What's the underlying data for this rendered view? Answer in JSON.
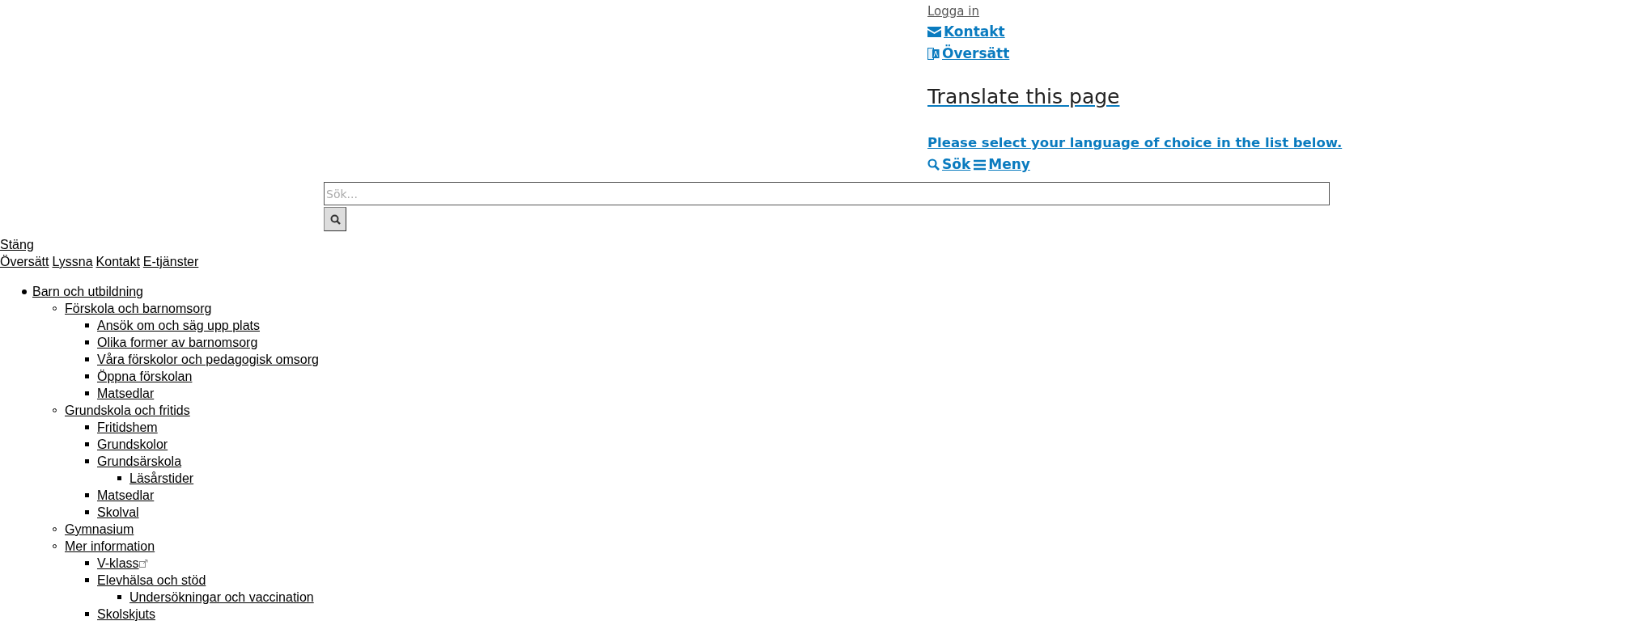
{
  "header_links": {
    "login": "Logga in",
    "contact": "Kontakt",
    "translate": "Översätt"
  },
  "translate_panel": {
    "title": "Translate this page",
    "instruction": "Please select your language of choice in the list below."
  },
  "header_actions": {
    "search": "Sök",
    "menu": "Meny"
  },
  "search": {
    "placeholder": "Sök..."
  },
  "menu": {
    "close": "Stäng",
    "quick_links": [
      "Översätt",
      "Lyssna",
      "Kontakt",
      "E-tjänster"
    ],
    "items": [
      {
        "label": "Barn och utbildning",
        "children": [
          {
            "label": "Förskola och barnomsorg",
            "children": [
              {
                "label": "Ansök om och säg upp plats"
              },
              {
                "label": "Olika former av barnomsorg"
              },
              {
                "label": "Våra förskolor och pedagogisk omsorg"
              },
              {
                "label": "Öppna förskolan"
              },
              {
                "label": "Matsedlar"
              }
            ]
          },
          {
            "label": "Grundskola och fritids",
            "children": [
              {
                "label": "Fritidshem"
              },
              {
                "label": "Grundskolor"
              },
              {
                "label": "Grundsärskola",
                "children": [
                  {
                    "label": "Läsårstider"
                  }
                ]
              },
              {
                "label": "Matsedlar"
              },
              {
                "label": "Skolval"
              }
            ]
          },
          {
            "label": "Gymnasium"
          },
          {
            "label": "Mer information",
            "children": [
              {
                "label": "V-klass",
                "external": true
              },
              {
                "label": "Elevhälsa och stöd",
                "children": [
                  {
                    "label": "Undersökningar och vaccination"
                  }
                ]
              },
              {
                "label": "Skolskjuts"
              }
            ]
          }
        ]
      }
    ]
  }
}
